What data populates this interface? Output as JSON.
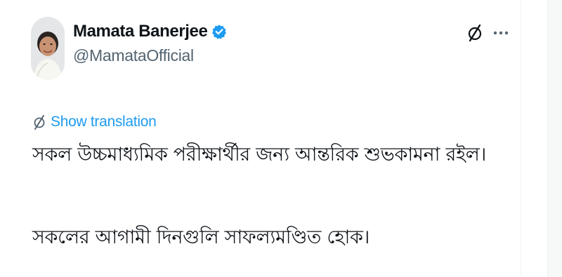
{
  "author": {
    "display_name": "Mamata Banerjee",
    "handle": "@MamataOfficial",
    "verified": true,
    "avatar": "profile-photo"
  },
  "actions": {
    "grok_icon": "grok-slash-icon",
    "more_icon": "more-horizontal-icon"
  },
  "translation": {
    "label": "Show translation",
    "icon": "grok-slash-icon"
  },
  "tweet": {
    "lines": [
      "সকল উচ্চমাধ্যমিক পরীক্ষার্থীর জন্য আন্তরিক শুভকামনা রইল।",
      "সকলের আগামী দিনগুলি সাফল্যমণ্ডিত হোক।"
    ]
  },
  "colors": {
    "text_primary": "#0f1419",
    "text_secondary": "#536471",
    "accent_blue": "#1d9bf0",
    "border": "#eff3f4"
  }
}
